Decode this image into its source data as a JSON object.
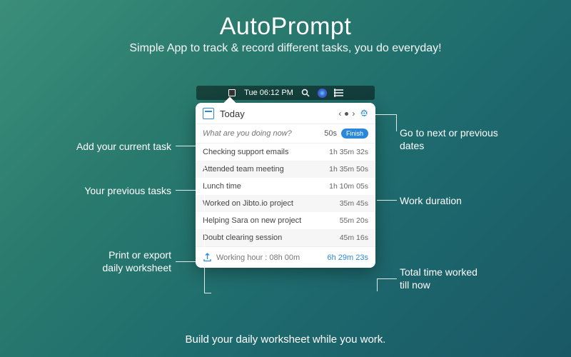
{
  "hero": {
    "title": "AutoPrompt",
    "subtitle": "Simple App to track & record different tasks, you do everyday!",
    "footer": "Build your daily worksheet while you work."
  },
  "menubar": {
    "time": "Tue 06:12 PM"
  },
  "popover": {
    "title": "Today",
    "input": {
      "placeholder": "What are you doing now?",
      "elapsed": "50s",
      "finish": "Finish"
    },
    "tasks": [
      {
        "name": "Checking support emails",
        "duration": "1h 35m 32s"
      },
      {
        "name": "Attended team meeting",
        "duration": "1h 35m 50s"
      },
      {
        "name": "Lunch time",
        "duration": "1h 10m 05s"
      },
      {
        "name": "Worked on Jibto.io project",
        "duration": "35m 45s"
      },
      {
        "name": "Helping Sara on new project",
        "duration": "55m 20s"
      },
      {
        "name": "Doubt clearing session",
        "duration": "45m 16s"
      }
    ],
    "footer": {
      "label": "Working hour : 08h 00m",
      "total": "6h 29m 23s"
    }
  },
  "callouts": {
    "addTask": "Add your current task",
    "prevTasks": "Your previous tasks",
    "export": "Print or export\ndaily worksheet",
    "navDates": "Go to next or previous\ndates",
    "workDur": "Work duration",
    "totalTime": "Total time worked\ntill now"
  }
}
